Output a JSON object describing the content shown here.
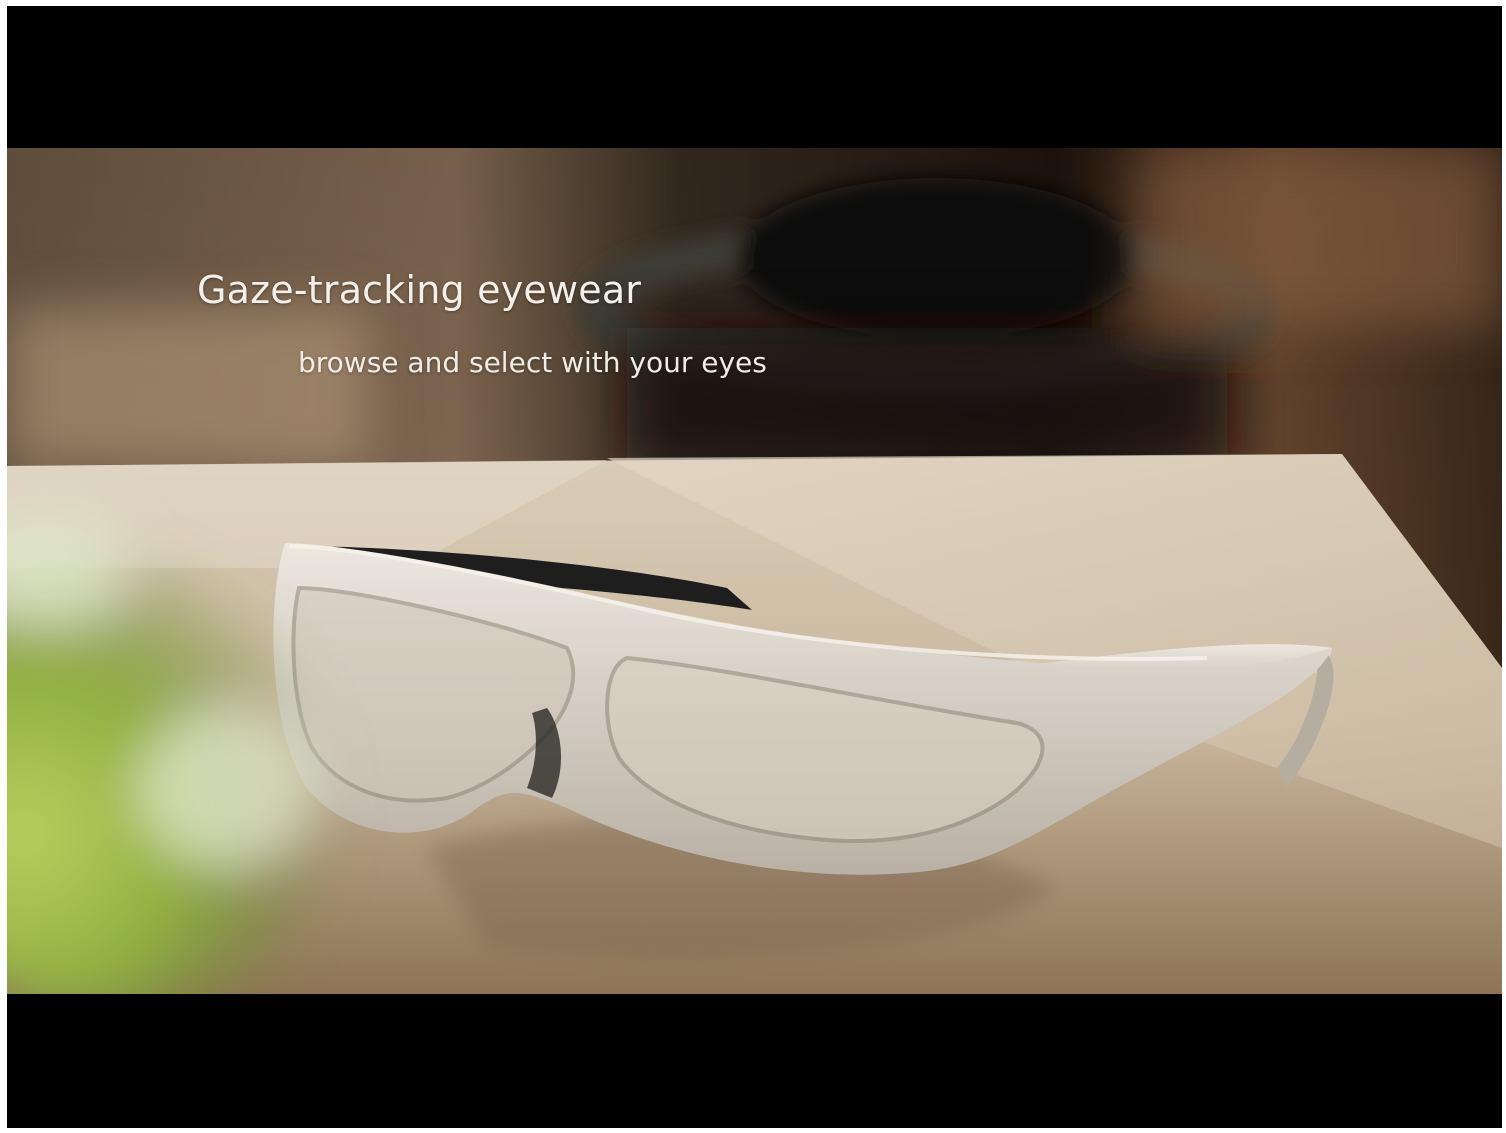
{
  "video_frame": {
    "caption": {
      "title": "Gaze-tracking eyewear",
      "subtitle": "browse and select with your eyes"
    },
    "colors": {
      "letterbox": "#000000",
      "caption_text": "#f4efe8",
      "frame_color": "#d8d1c6",
      "temple_color": "#1e1e1e",
      "table_color": "#c8b8a0",
      "foreground_plant": "#8fb040"
    }
  }
}
